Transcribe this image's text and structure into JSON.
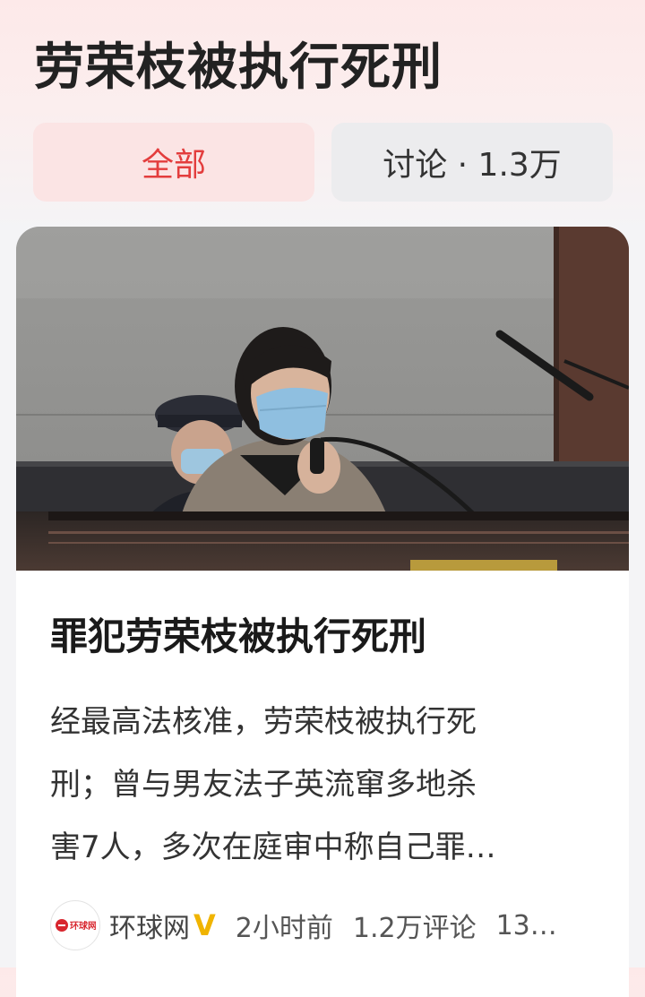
{
  "topic": {
    "title": "劳荣枝被执行死刑"
  },
  "tabs": [
    {
      "label": "全部",
      "active": true
    },
    {
      "label": "讨论 · 1.3万",
      "active": false
    }
  ],
  "article": {
    "image_alt": "courtroom-photo",
    "title": "罪犯劳荣枝被执行死刑",
    "summary_lines": [
      "经最高法核准，劳荣枝被执行死",
      "刑；曾与男友法子英流窜多地杀",
      "害7人，多次在庭审中称自己罪…"
    ],
    "meta": {
      "source_logo_text": "环球网",
      "source": "环球网",
      "verified_icon": "verified-v-icon",
      "time": "2小时前",
      "comments": "1.2万评论",
      "more": "13…"
    }
  },
  "colors": {
    "accent": "#e33d3d",
    "active_tab_bg": "#fbe4e4",
    "inactive_tab_bg": "#ececee",
    "verified": "#f0b400"
  }
}
